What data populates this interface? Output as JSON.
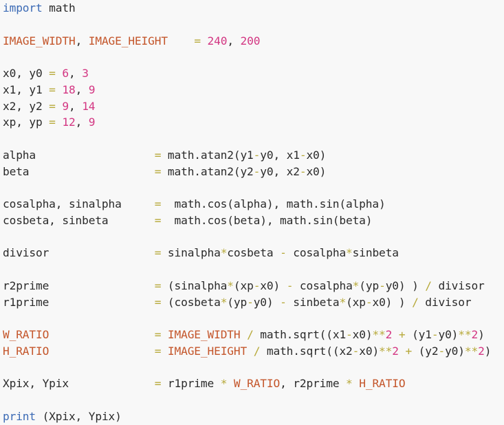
{
  "colors": {
    "background": "#f8f8f8",
    "text": "#2a2a2a",
    "keyword": "#3b6ab5",
    "constant": "#c4562b",
    "number": "#d33682",
    "operator": "#b7a93a"
  },
  "code": {
    "lines": [
      [
        [
          "keyword",
          "import"
        ],
        [
          "plain",
          " math"
        ]
      ],
      [],
      [
        [
          "constant",
          "IMAGE_WIDTH"
        ],
        [
          "plain",
          ", "
        ],
        [
          "constant",
          "IMAGE_HEIGHT"
        ],
        [
          "plain",
          "    "
        ],
        [
          "assign",
          "="
        ],
        [
          "plain",
          " "
        ],
        [
          "number",
          "240"
        ],
        [
          "plain",
          ", "
        ],
        [
          "number",
          "200"
        ]
      ],
      [],
      [
        [
          "plain",
          "x0, y0 "
        ],
        [
          "assign",
          "="
        ],
        [
          "plain",
          " "
        ],
        [
          "number",
          "6"
        ],
        [
          "plain",
          ", "
        ],
        [
          "number",
          "3"
        ]
      ],
      [
        [
          "plain",
          "x1, y1 "
        ],
        [
          "assign",
          "="
        ],
        [
          "plain",
          " "
        ],
        [
          "number",
          "18"
        ],
        [
          "plain",
          ", "
        ],
        [
          "number",
          "9"
        ]
      ],
      [
        [
          "plain",
          "x2, y2 "
        ],
        [
          "assign",
          "="
        ],
        [
          "plain",
          " "
        ],
        [
          "number",
          "9"
        ],
        [
          "plain",
          ", "
        ],
        [
          "number",
          "14"
        ]
      ],
      [
        [
          "plain",
          "xp, yp "
        ],
        [
          "assign",
          "="
        ],
        [
          "plain",
          " "
        ],
        [
          "number",
          "12"
        ],
        [
          "plain",
          ", "
        ],
        [
          "number",
          "9"
        ]
      ],
      [],
      [
        [
          "plain",
          "alpha                  "
        ],
        [
          "assign",
          "="
        ],
        [
          "plain",
          " math.atan2(y1"
        ],
        [
          "operator",
          "-"
        ],
        [
          "plain",
          "y0, x1"
        ],
        [
          "operator",
          "-"
        ],
        [
          "plain",
          "x0)"
        ]
      ],
      [
        [
          "plain",
          "beta                   "
        ],
        [
          "assign",
          "="
        ],
        [
          "plain",
          " math.atan2(y2"
        ],
        [
          "operator",
          "-"
        ],
        [
          "plain",
          "y0, x2"
        ],
        [
          "operator",
          "-"
        ],
        [
          "plain",
          "x0)"
        ]
      ],
      [],
      [
        [
          "plain",
          "cosalpha, sinalpha     "
        ],
        [
          "assign",
          "="
        ],
        [
          "plain",
          "  math.cos(alpha), math.sin(alpha)"
        ]
      ],
      [
        [
          "plain",
          "cosbeta, sinbeta       "
        ],
        [
          "assign",
          "="
        ],
        [
          "plain",
          "  math.cos(beta), math.sin(beta)"
        ]
      ],
      [],
      [
        [
          "plain",
          "divisor                "
        ],
        [
          "assign",
          "="
        ],
        [
          "plain",
          " sinalpha"
        ],
        [
          "operator",
          "*"
        ],
        [
          "plain",
          "cosbeta "
        ],
        [
          "operator",
          "-"
        ],
        [
          "plain",
          " cosalpha"
        ],
        [
          "operator",
          "*"
        ],
        [
          "plain",
          "sinbeta"
        ]
      ],
      [],
      [
        [
          "plain",
          "r2prime                "
        ],
        [
          "assign",
          "="
        ],
        [
          "plain",
          " (sinalpha"
        ],
        [
          "operator",
          "*"
        ],
        [
          "plain",
          "(xp"
        ],
        [
          "operator",
          "-"
        ],
        [
          "plain",
          "x0) "
        ],
        [
          "operator",
          "-"
        ],
        [
          "plain",
          " cosalpha"
        ],
        [
          "operator",
          "*"
        ],
        [
          "plain",
          "(yp"
        ],
        [
          "operator",
          "-"
        ],
        [
          "plain",
          "y0) ) "
        ],
        [
          "operator",
          "/"
        ],
        [
          "plain",
          " divisor"
        ]
      ],
      [
        [
          "plain",
          "r1prime                "
        ],
        [
          "assign",
          "="
        ],
        [
          "plain",
          " (cosbeta"
        ],
        [
          "operator",
          "*"
        ],
        [
          "plain",
          "(yp"
        ],
        [
          "operator",
          "-"
        ],
        [
          "plain",
          "y0) "
        ],
        [
          "operator",
          "-"
        ],
        [
          "plain",
          " sinbeta"
        ],
        [
          "operator",
          "*"
        ],
        [
          "plain",
          "(xp"
        ],
        [
          "operator",
          "-"
        ],
        [
          "plain",
          "x0) ) "
        ],
        [
          "operator",
          "/"
        ],
        [
          "plain",
          " divisor"
        ]
      ],
      [],
      [
        [
          "constant",
          "W_RATIO"
        ],
        [
          "plain",
          "                "
        ],
        [
          "assign",
          "="
        ],
        [
          "plain",
          " "
        ],
        [
          "constant",
          "IMAGE_WIDTH"
        ],
        [
          "plain",
          " "
        ],
        [
          "operator",
          "/"
        ],
        [
          "plain",
          " math.sqrt((x1"
        ],
        [
          "operator",
          "-"
        ],
        [
          "plain",
          "x0)"
        ],
        [
          "operator",
          "**"
        ],
        [
          "number",
          "2"
        ],
        [
          "plain",
          " "
        ],
        [
          "operator",
          "+"
        ],
        [
          "plain",
          " (y1"
        ],
        [
          "operator",
          "-"
        ],
        [
          "plain",
          "y0)"
        ],
        [
          "operator",
          "**"
        ],
        [
          "number",
          "2"
        ],
        [
          "plain",
          ")"
        ]
      ],
      [
        [
          "constant",
          "H_RATIO"
        ],
        [
          "plain",
          "                "
        ],
        [
          "assign",
          "="
        ],
        [
          "plain",
          " "
        ],
        [
          "constant",
          "IMAGE_HEIGHT"
        ],
        [
          "plain",
          " "
        ],
        [
          "operator",
          "/"
        ],
        [
          "plain",
          " math.sqrt((x2"
        ],
        [
          "operator",
          "-"
        ],
        [
          "plain",
          "x0)"
        ],
        [
          "operator",
          "**"
        ],
        [
          "number",
          "2"
        ],
        [
          "plain",
          " "
        ],
        [
          "operator",
          "+"
        ],
        [
          "plain",
          " (y2"
        ],
        [
          "operator",
          "-"
        ],
        [
          "plain",
          "y0)"
        ],
        [
          "operator",
          "**"
        ],
        [
          "number",
          "2"
        ],
        [
          "plain",
          ")"
        ]
      ],
      [],
      [
        [
          "plain",
          "Xpix, Ypix             "
        ],
        [
          "assign",
          "="
        ],
        [
          "plain",
          " r1prime "
        ],
        [
          "operator",
          "*"
        ],
        [
          "plain",
          " "
        ],
        [
          "constant",
          "W_RATIO"
        ],
        [
          "plain",
          ", r2prime "
        ],
        [
          "operator",
          "*"
        ],
        [
          "plain",
          " "
        ],
        [
          "constant",
          "H_RATIO"
        ]
      ],
      [],
      [
        [
          "keyword",
          "print"
        ],
        [
          "plain",
          " (Xpix, Ypix)"
        ]
      ]
    ]
  }
}
